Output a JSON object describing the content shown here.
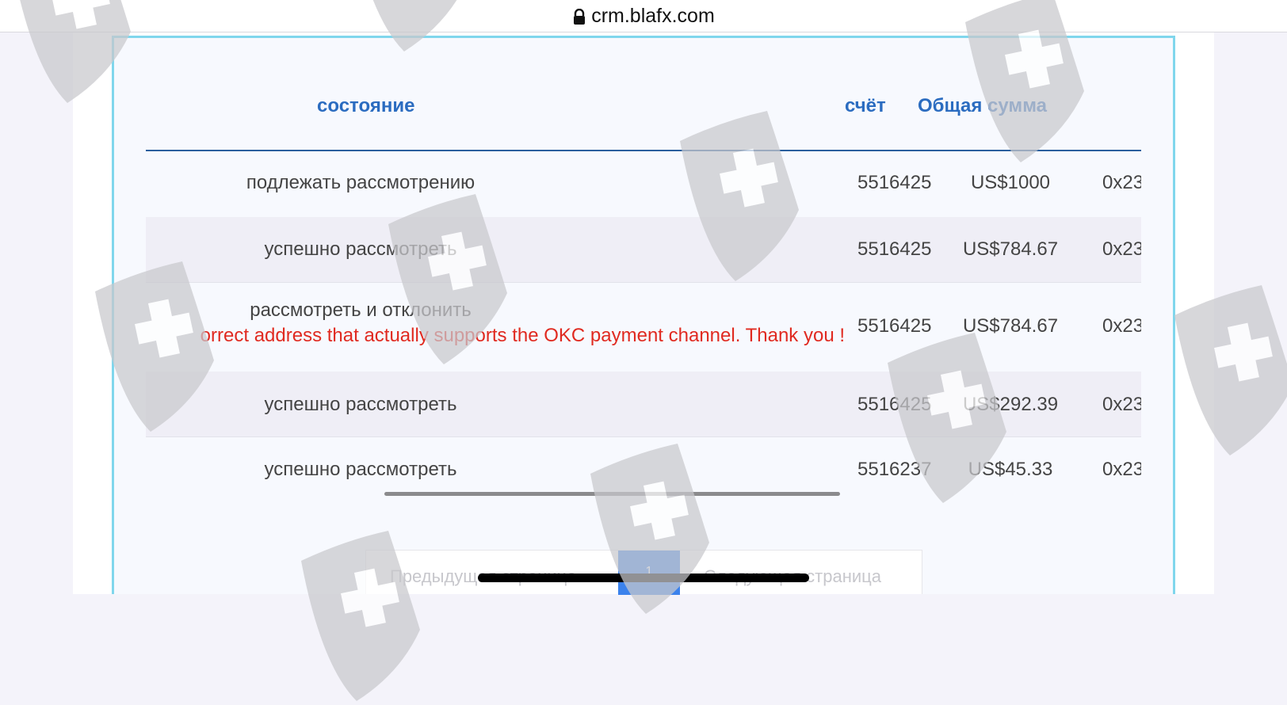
{
  "browser": {
    "url": "crm.blafx.com"
  },
  "table": {
    "headers": {
      "status": "состояние",
      "account": "счёт",
      "total": "Общая сумма"
    },
    "rows": [
      {
        "status": "подлежать рассмотрению",
        "account": "5516425",
        "amount": "US$1000",
        "tail": "0x23"
      },
      {
        "status": "успешно рассмотреть",
        "account": "5516425",
        "amount": "US$784.67",
        "tail": "0x23"
      },
      {
        "status": "рассмотреть и отклонить",
        "reason": "orrect address that actually supports the OKC payment channel. Thank you !",
        "account": "5516425",
        "amount": "US$784.67",
        "tail": "0x23"
      },
      {
        "status": "успешно рассмотреть",
        "account": "5516425",
        "amount": "US$292.39",
        "tail": "0x23"
      },
      {
        "status": "успешно рассмотреть",
        "account": "5516237",
        "amount": "US$45.33",
        "tail": "0x23"
      }
    ]
  },
  "pagination": {
    "prev_label": "Предыдущая страница",
    "current_page": "1",
    "next_label": "Следующая страница"
  },
  "colors": {
    "accent": "#2b6cc0",
    "reject_text": "#e02a20",
    "page_active": "#3b82ec",
    "panel_border": "#80d6ec"
  },
  "watermark_icon": "shield-cross-icon"
}
